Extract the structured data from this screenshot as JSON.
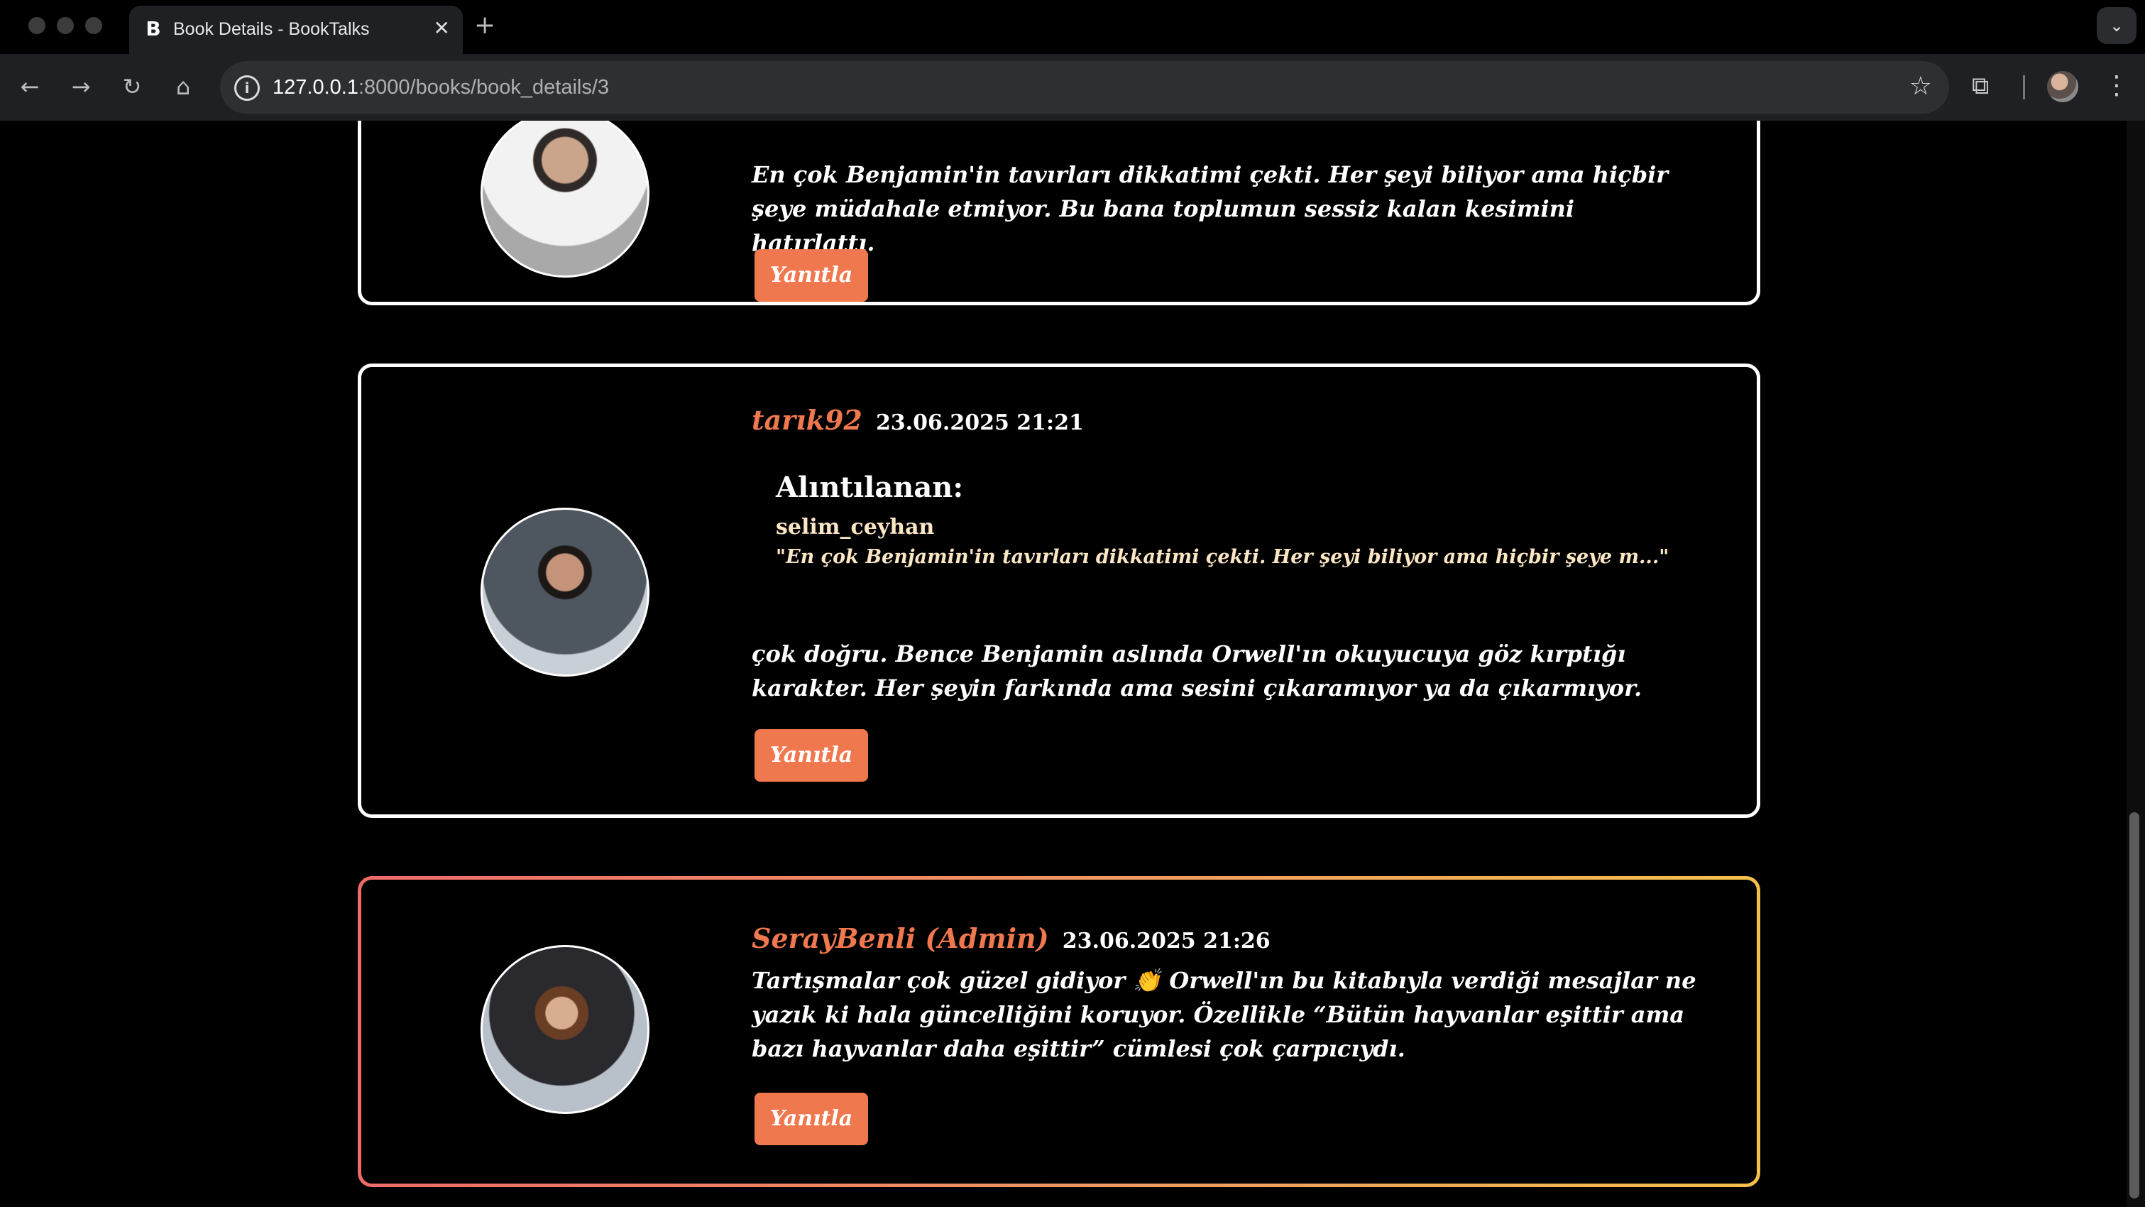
{
  "browser": {
    "tab_title": "Book Details - BookTalks",
    "tab_favicon": "B",
    "url_host": "127.0.0.1",
    "url_path": ":8000/books/book_details/3"
  },
  "comments": [
    {
      "username": "",
      "timestamp": "",
      "text": "En çok Benjamin'in tavırları dikkatimi çekti. Her şeyi biliyor ama hiçbir şeye müdahale etmiyor. Bu bana toplumun sessiz kalan kesimini hatırlattı.",
      "reply_label": "Yanıtla"
    },
    {
      "username": "tarık92",
      "timestamp": "23.06.2025 21:21",
      "quote": {
        "heading": "Alıntılanan:",
        "user": "selim_ceyhan",
        "text": "\"En çok Benjamin'in tavırları dikkatimi çekti. Her şeyi biliyor ama hiçbir şeye m...\""
      },
      "text": "çok doğru. Bence Benjamin aslında Orwell'ın okuyucuya göz kırptığı karakter. Her şeyin farkında ama sesini çıkaramıyor ya da çıkarmıyor.",
      "reply_label": "Yanıtla"
    },
    {
      "username": "SerayBenli (Admin)",
      "timestamp": "23.06.2025 21:26",
      "text": "Tartışmalar çok güzel gidiyor 👏 Orwell'ın bu kitabıyla verdiği mesajlar ne yazık ki hala güncelliğini koruyor. Özellikle “Bütün hayvanlar eşittir ama bazı hayvanlar daha eşittir” cümlesi çok çarpıcıydı.",
      "reply_label": "Yanıtla"
    }
  ],
  "colors": {
    "accent": "#f0784e",
    "admin_border_start": "#f06a6a",
    "admin_border_end": "#f5c04a",
    "quote_text": "#fbe6c4"
  }
}
